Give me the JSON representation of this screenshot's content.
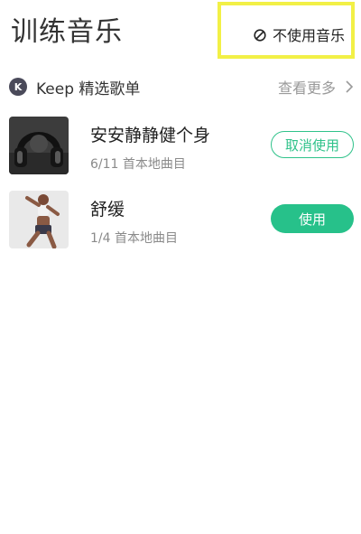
{
  "header": {
    "title": "训练音乐",
    "no_music_label": "不使用音乐"
  },
  "section": {
    "title": "Keep 精选歌单",
    "view_more": "查看更多",
    "logo_letter": "K"
  },
  "playlists": [
    {
      "name": "安安静静健个身",
      "count": "6/11 首本地曲目",
      "action": "取消使用",
      "selected": true
    },
    {
      "name": "舒缓",
      "count": "1/4 首本地曲目",
      "action": "使用",
      "selected": false
    }
  ],
  "colors": {
    "accent": "#27c18a",
    "highlight_border": "#f2f046",
    "muted": "#9a9a9a"
  }
}
